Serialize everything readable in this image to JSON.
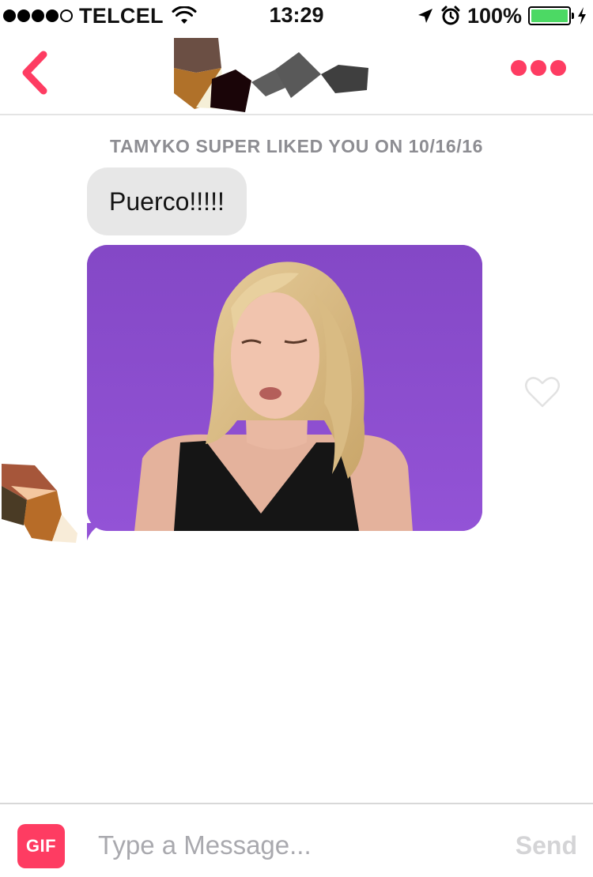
{
  "status_bar": {
    "carrier": "TELCEL",
    "time": "13:29",
    "battery": "100%",
    "battery_level": 1.0,
    "signal_bars_filled": 4,
    "signal_bars_total": 5
  },
  "header": {
    "back_icon": "chevron-left-icon",
    "more_icon": "more-dots-icon",
    "accent_color": "#fe3c62"
  },
  "chat": {
    "match_note": "TAMYKO SUPER LIKED YOU ON 10/16/16",
    "messages": [
      {
        "type": "text",
        "text": "Puerco!!!!!"
      },
      {
        "type": "gif",
        "description_icon": "gif-image"
      }
    ],
    "like_icon": "heart-outline-icon"
  },
  "composer": {
    "gif_label": "GIF",
    "placeholder": "Type a Message...",
    "send_label": "Send"
  }
}
